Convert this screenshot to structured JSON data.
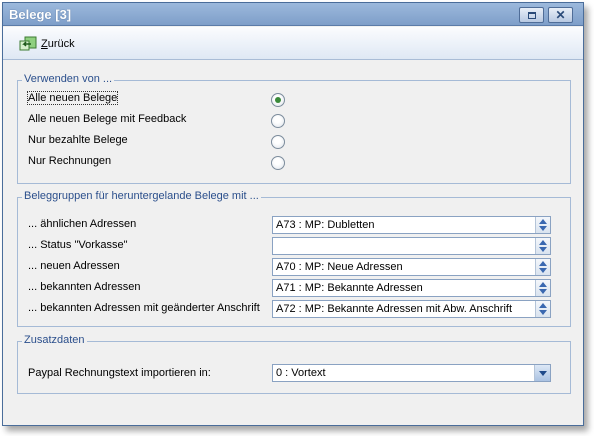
{
  "window": {
    "title": "Belege [3]"
  },
  "toolbar": {
    "back_label_underlined": "Z",
    "back_label_rest": "urück"
  },
  "section_usage": {
    "title": "Verwenden von ...",
    "options": [
      {
        "label": "Alle neuen Belege",
        "selected": true
      },
      {
        "label": "Alle neuen Belege mit Feedback",
        "selected": false
      },
      {
        "label": "Nur bezahlte Belege",
        "selected": false
      },
      {
        "label": "Nur Rechnungen",
        "selected": false
      }
    ]
  },
  "section_groups": {
    "title": "Beleggruppen für heruntergelande Belege mit ...",
    "rows": [
      {
        "label": "... ähnlichen Adressen",
        "value": "A73 : MP: Dubletten"
      },
      {
        "label": "... Status \"Vorkasse\"",
        "value": ""
      },
      {
        "label": "... neuen Adressen",
        "value": "A70 : MP: Neue Adressen"
      },
      {
        "label": "... bekannten Adressen",
        "value": "A71 : MP: Bekannte Adressen"
      },
      {
        "label": "... bekannten Adressen mit geänderter Anschrift",
        "value": "A72 : MP: Bekannte Adressen mit Abw. Anschrift"
      }
    ]
  },
  "section_extra": {
    "title": "Zusatzdaten",
    "paypal_label": "Paypal Rechnungstext importieren in:",
    "paypal_value": "0 : Vortext"
  },
  "colors": {
    "titlebar": "#8aabd4",
    "group_title": "#2b4f8c",
    "radio_selected": "#3a8a3a"
  }
}
